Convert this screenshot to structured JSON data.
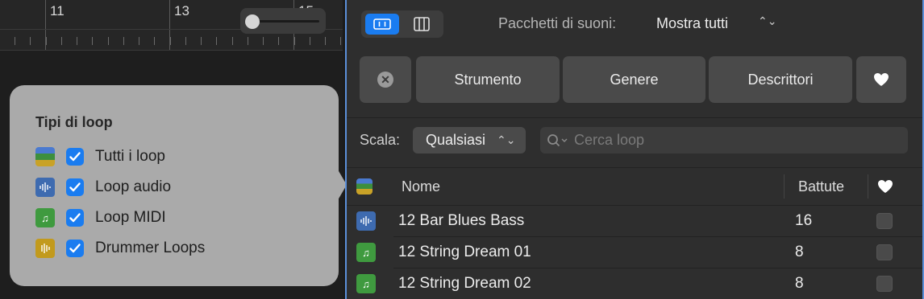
{
  "ruler": {
    "bars": [
      "11",
      "13",
      "15"
    ]
  },
  "popover": {
    "title": "Tipi di loop",
    "items": [
      {
        "label": "Tutti i loop",
        "icon": "all-loops-icon",
        "checked": true
      },
      {
        "label": "Loop audio",
        "icon": "audio-loop-icon",
        "checked": true
      },
      {
        "label": "Loop MIDI",
        "icon": "midi-loop-icon",
        "checked": true
      },
      {
        "label": "Drummer Loops",
        "icon": "drummer-loop-icon",
        "checked": true
      }
    ]
  },
  "browser": {
    "packs_label": "Pacchetti di suoni:",
    "packs_value": "Mostra tutti",
    "filters": [
      "Strumento",
      "Genere",
      "Descrittori"
    ],
    "scale_label": "Scala:",
    "scale_value": "Qualsiasi",
    "search_placeholder": "Cerca loop",
    "columns": {
      "name": "Nome",
      "bars": "Battute"
    },
    "rows": [
      {
        "name": "12 Bar Blues Bass",
        "bars": "16",
        "type": "audio"
      },
      {
        "name": "12 String Dream 01",
        "bars": "8",
        "type": "midi"
      },
      {
        "name": "12 String Dream 02",
        "bars": "8",
        "type": "midi"
      }
    ]
  },
  "colors": {
    "accent": "#1a7cf0",
    "audio": "#3e6bb0",
    "midi": "#3f9a3f",
    "drummer": "#c29a1d"
  }
}
